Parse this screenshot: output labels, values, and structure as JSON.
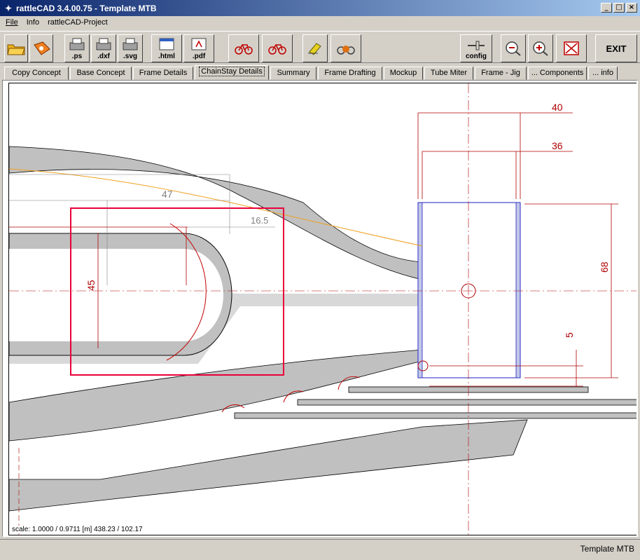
{
  "window": {
    "title": "rattleCAD  3.4.00.75 - Template MTB"
  },
  "menu": [
    "File",
    "Info",
    "rattleCAD-Project"
  ],
  "toolbar": {
    "ps": ".ps",
    "dxf": ".dxf",
    "svg": ".svg",
    "html": ".html",
    "pdf": ".pdf",
    "config": "config",
    "exit": "EXIT"
  },
  "tabs": [
    "Copy Concept",
    "Base Concept",
    "Frame Details",
    "ChainStay Details",
    "Summary",
    "Frame Drafting",
    "Mockup",
    "Tube Miter",
    "Frame - Jig",
    "... Components",
    "... info"
  ],
  "active_tab": "ChainStay Details",
  "dimensions": {
    "d40": "40",
    "d36": "36",
    "d47": "47",
    "d16_5": "16.5",
    "d45": "45",
    "d68": "68",
    "d5": "5"
  },
  "scale_readout": "scale: 1.0000 / 0.9711  [m]  438.23 / 102.17",
  "status": "Template MTB",
  "colors": {
    "title_start": "#0a246a",
    "title_end": "#a6caf0",
    "dim_red": "#b00000",
    "accent_red": "#e8003a",
    "tube_grey": "#c0c0c0",
    "light_grey": "#d8d8d8",
    "orange": "#f0a020",
    "blue": "#2020c0"
  }
}
